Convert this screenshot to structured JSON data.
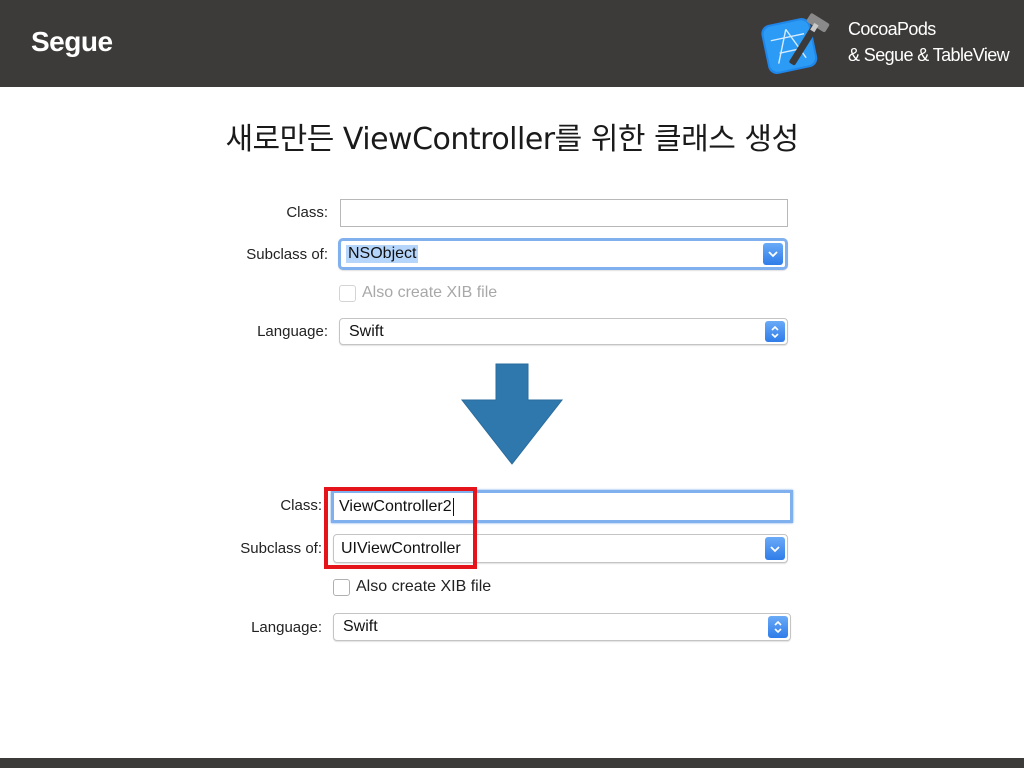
{
  "header": {
    "title": "Segue",
    "subtitle_line1": "CocoaPods",
    "subtitle_line2": "& Segue & TableView"
  },
  "slide_title": "새로만든 ViewController를 위한 클래스 생성",
  "before": {
    "class_label": "Class:",
    "class_value": "",
    "subclass_label": "Subclass of:",
    "subclass_value": "NSObject",
    "xib_label": "Also create XIB file",
    "xib_checked": false,
    "xib_enabled": false,
    "language_label": "Language:",
    "language_value": "Swift"
  },
  "after": {
    "class_label": "Class:",
    "class_value": "ViewController2",
    "subclass_label": "Subclass of:",
    "subclass_value": "UIViewController",
    "xib_label": "Also create XIB file",
    "xib_checked": false,
    "xib_enabled": true,
    "language_label": "Language:",
    "language_value": "Swift"
  },
  "icons": {
    "logo": "xcode-icon",
    "arrow": "down-arrow-icon"
  },
  "colors": {
    "header_bg": "#3c3b39",
    "arrow": "#2f78ad",
    "highlight": "#e5141b",
    "focus_ring": "#80b0ee",
    "popup_button": "#3b86ee"
  }
}
